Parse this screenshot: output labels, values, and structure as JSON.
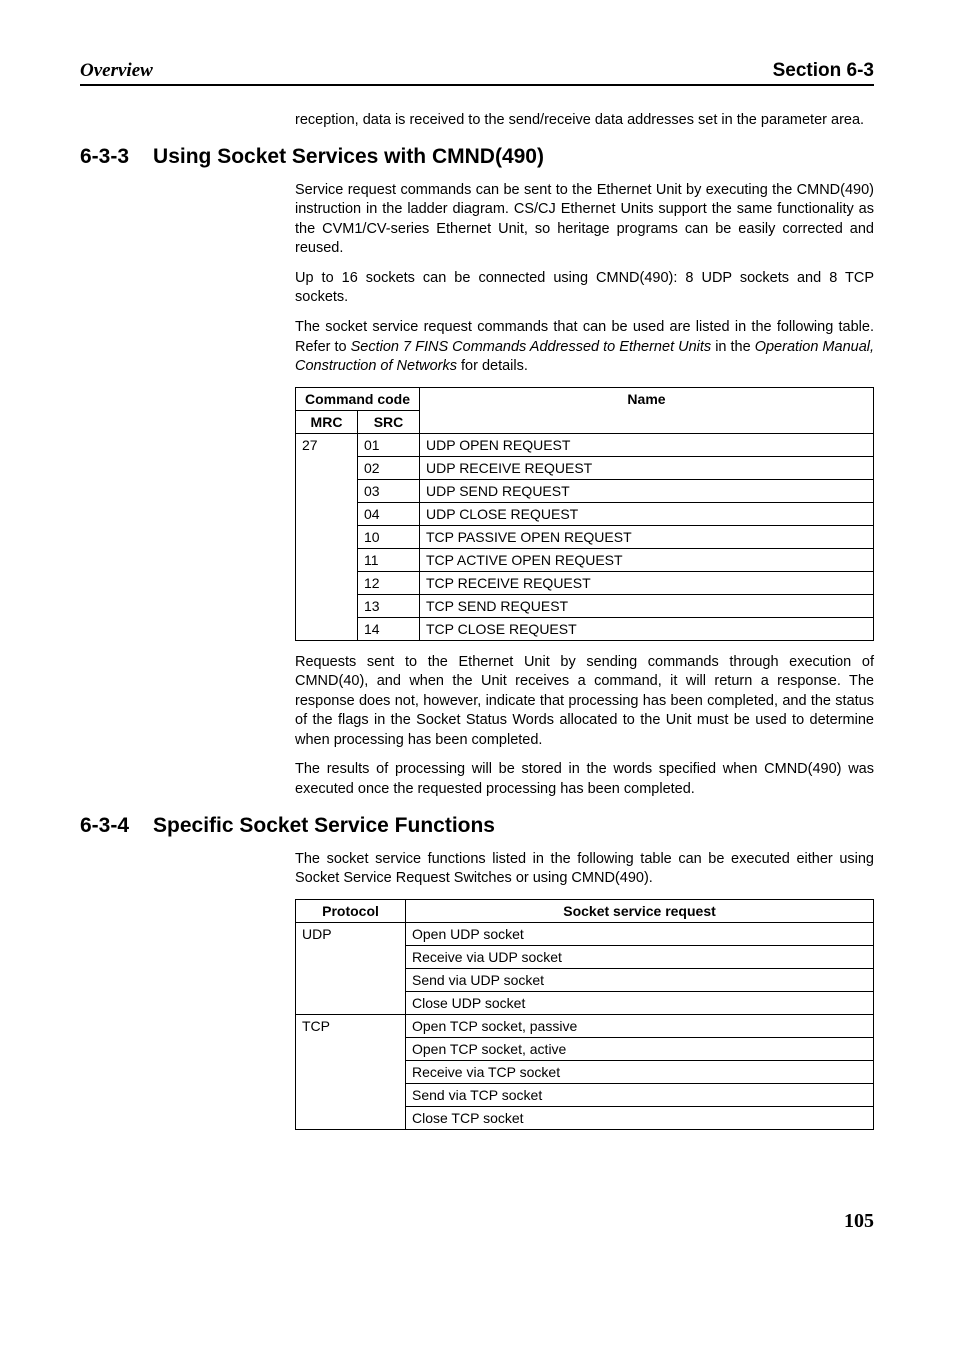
{
  "header": {
    "left": "Overview",
    "right": "Section 6-3"
  },
  "intro_para": "reception, data is received to the send/receive data addresses set in the parameter area.",
  "section_633": {
    "num": "6-3-3",
    "title": "Using Socket Services with CMND(490)",
    "p1": "Service request commands can be sent to the Ethernet Unit by executing the CMND(490) instruction in the ladder diagram. CS/CJ Ethernet Units support the same functionality as the CVM1/CV-series Ethernet Unit, so heritage programs can be easily corrected and reused.",
    "p2": "Up to 16 sockets can be connected using CMND(490): 8 UDP sockets and 8 TCP sockets.",
    "p3a": "The socket service request commands that can be used are listed in the following table. Refer to ",
    "p3b": "Section 7 FINS Commands Addressed to Ethernet Units",
    "p3c": " in the ",
    "p3d": "Operation Manual, Construction of Networks",
    "p3e": " for details.",
    "table": {
      "head": {
        "cmdcode": "Command code",
        "mrc": "MRC",
        "src": "SRC",
        "name": "Name"
      },
      "mrc": "27",
      "rows": [
        {
          "src": "01",
          "name": "UDP OPEN REQUEST"
        },
        {
          "src": "02",
          "name": "UDP RECEIVE REQUEST"
        },
        {
          "src": "03",
          "name": "UDP SEND REQUEST"
        },
        {
          "src": "04",
          "name": "UDP CLOSE REQUEST"
        },
        {
          "src": "10",
          "name": "TCP PASSIVE OPEN REQUEST"
        },
        {
          "src": "11",
          "name": "TCP ACTIVE OPEN REQUEST"
        },
        {
          "src": "12",
          "name": "TCP RECEIVE REQUEST"
        },
        {
          "src": "13",
          "name": "TCP SEND REQUEST"
        },
        {
          "src": "14",
          "name": "TCP CLOSE REQUEST"
        }
      ]
    },
    "p4": "Requests sent to the Ethernet Unit by sending commands through execution of CMND(40), and when the Unit receives a command, it will return a response. The response does not, however, indicate that processing has been completed, and the status of the flags in the Socket Status Words allocated to the Unit must be used to determine when processing has been completed.",
    "p5": "The results of processing will be stored in the words specified when CMND(490) was executed once the requested processing has been completed."
  },
  "section_634": {
    "num": "6-3-4",
    "title": "Specific Socket Service Functions",
    "p1": "The socket service functions listed in the following table can be executed either using Socket Service Request Switches or using CMND(490).",
    "table": {
      "head": {
        "proto": "Protocol",
        "req": "Socket service request"
      },
      "groups": [
        {
          "proto": "UDP",
          "reqs": [
            "Open UDP socket",
            "Receive via UDP socket",
            "Send via UDP socket",
            "Close UDP socket"
          ]
        },
        {
          "proto": "TCP",
          "reqs": [
            "Open TCP socket, passive",
            "Open TCP socket, active",
            "Receive via TCP socket",
            "Send via TCP socket",
            "Close TCP socket"
          ]
        }
      ]
    }
  },
  "page_num": "105"
}
